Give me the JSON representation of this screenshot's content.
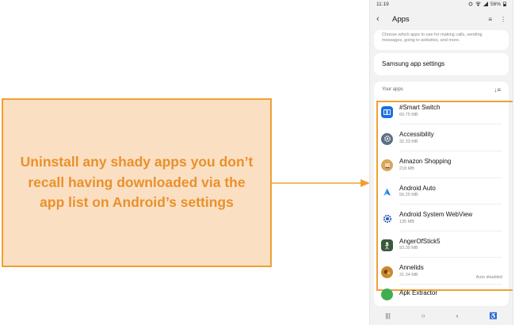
{
  "callout": {
    "text": "Uninstall any shady apps you don’t recall having downloaded via the app list on Android’s settings"
  },
  "statusbar": {
    "time": "11:19",
    "battery": "56%"
  },
  "appbar": {
    "title": "Apps",
    "back_icon": "‹",
    "filter_icon": "≡",
    "more_icon": "⋮"
  },
  "description": "Choose which apps to use for making calls, sending messages, going to websites, and more.",
  "settings": {
    "label": "Samsung app settings"
  },
  "section": {
    "label": "Your apps",
    "sort_icon": "↓≡"
  },
  "apps": [
    {
      "name": "#Smart Switch",
      "size": "60.75 MB",
      "icon": "smart-switch-icon",
      "color": "#1a6fe0"
    },
    {
      "name": "Accessibility",
      "size": "32.33 MB",
      "icon": "accessibility-gear-icon",
      "color": "#5d6f85"
    },
    {
      "name": "Amazon Shopping",
      "size": "218 MB",
      "icon": "amazon-shopping-icon",
      "color": "#d9a55b"
    },
    {
      "name": "Android Auto",
      "size": "56.25 MB",
      "icon": "android-auto-icon",
      "color": "#ffffff"
    },
    {
      "name": "Android System WebView",
      "size": "135 MB",
      "icon": "webview-gear-icon",
      "color": "#ffffff"
    },
    {
      "name": "AngerOfStick5",
      "size": "93.30 MB",
      "icon": "anger-of-stick-icon",
      "color": "#3b5a3a"
    },
    {
      "name": "Annelids",
      "size": "31.34 MB",
      "icon": "annelids-icon",
      "color": "#c9882e",
      "badge": "Auto disabled"
    },
    {
      "name": "Apk Extractor",
      "size": "",
      "icon": "apk-extractor-icon",
      "color": "#3fae52"
    }
  ],
  "navbar": {
    "recents": "|||",
    "home": "○",
    "back": "‹",
    "accessibility": "♿"
  },
  "colors": {
    "callout_fill": "#fbdfc3",
    "accent_orange": "#f0a033",
    "callout_text": "#e9912b"
  }
}
